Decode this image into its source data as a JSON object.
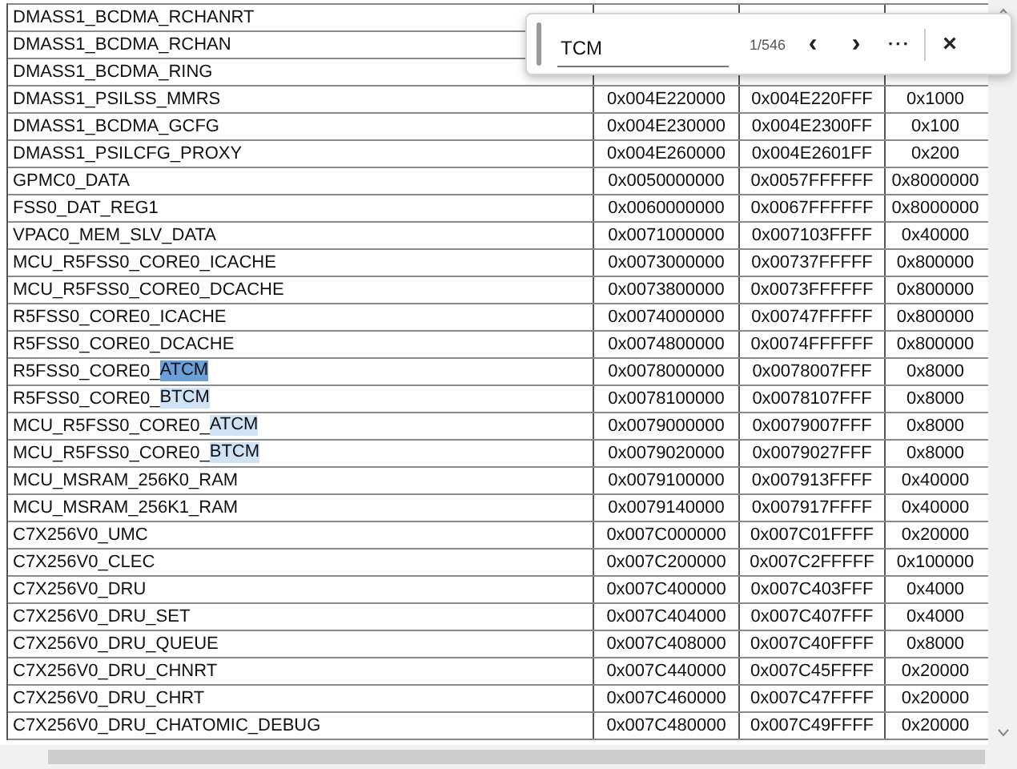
{
  "find_bar": {
    "query": "TCM",
    "count": "1/546",
    "prev": "‹",
    "next": "›",
    "more": "···",
    "close": "×"
  },
  "table": {
    "rows": [
      {
        "name": "DMASS1_BCDMA_RCHANRT"
      },
      {
        "name": "DMASS1_BCDMA_RCHAN"
      },
      {
        "name": "DMASS1_BCDMA_RING"
      },
      {
        "name": "DMASS1_PSILSS_MMRS",
        "start": "0x004E220000",
        "end": "0x004E220FFF",
        "size": "0x1000"
      },
      {
        "name": "DMASS1_BCDMA_GCFG",
        "start": "0x004E230000",
        "end": "0x004E2300FF",
        "size": "0x100"
      },
      {
        "name": "DMASS1_PSILCFG_PROXY",
        "start": "0x004E260000",
        "end": "0x004E2601FF",
        "size": "0x200"
      },
      {
        "name": "GPMC0_DATA",
        "start": "0x0050000000",
        "end": "0x0057FFFFFF",
        "size": "0x8000000"
      },
      {
        "name": "FSS0_DAT_REG1",
        "start": "0x0060000000",
        "end": "0x0067FFFFFF",
        "size": "0x8000000"
      },
      {
        "name": "VPAC0_MEM_SLV_DATA",
        "start": "0x0071000000",
        "end": "0x007103FFFF",
        "size": "0x40000"
      },
      {
        "name": "MCU_R5FSS0_CORE0_ICACHE",
        "start": "0x0073000000",
        "end": "0x00737FFFFF",
        "size": "0x800000"
      },
      {
        "name": "MCU_R5FSS0_CORE0_DCACHE",
        "start": "0x0073800000",
        "end": "0x0073FFFFFF",
        "size": "0x800000"
      },
      {
        "name": "R5FSS0_CORE0_ICACHE",
        "start": "0x0074000000",
        "end": "0x00747FFFFF",
        "size": "0x800000"
      },
      {
        "name": "R5FSS0_CORE0_DCACHE",
        "start": "0x0074800000",
        "end": "0x0074FFFFFF",
        "size": "0x800000"
      },
      {
        "name": "R5FSS0_CORE0_",
        "match": {
          "text": "ATCM",
          "current": true
        },
        "start": "0x0078000000",
        "end": "0x0078007FFF",
        "size": "0x8000"
      },
      {
        "name": "R5FSS0_CORE0_",
        "match": {
          "text": "BTCM",
          "current": false
        },
        "start": "0x0078100000",
        "end": "0x0078107FFF",
        "size": "0x8000"
      },
      {
        "name": "MCU_R5FSS0_CORE0_",
        "match": {
          "text": "ATCM",
          "current": false
        },
        "start": "0x0079000000",
        "end": "0x0079007FFF",
        "size": "0x8000"
      },
      {
        "name": "MCU_R5FSS0_CORE0_",
        "match": {
          "text": "BTCM",
          "current": false
        },
        "start": "0x0079020000",
        "end": "0x0079027FFF",
        "size": "0x8000"
      },
      {
        "name": "MCU_MSRAM_256K0_RAM",
        "start": "0x0079100000",
        "end": "0x007913FFFF",
        "size": "0x40000"
      },
      {
        "name": "MCU_MSRAM_256K1_RAM",
        "start": "0x0079140000",
        "end": "0x007917FFFF",
        "size": "0x40000"
      },
      {
        "name": "C7X256V0_UMC",
        "start": "0x007C000000",
        "end": "0x007C01FFFF",
        "size": "0x20000"
      },
      {
        "name": "C7X256V0_CLEC",
        "start": "0x007C200000",
        "end": "0x007C2FFFFF",
        "size": "0x100000"
      },
      {
        "name": "C7X256V0_DRU",
        "start": "0x007C400000",
        "end": "0x007C403FFF",
        "size": "0x4000"
      },
      {
        "name": "C7X256V0_DRU_SET",
        "start": "0x007C404000",
        "end": "0x007C407FFF",
        "size": "0x4000"
      },
      {
        "name": "C7X256V0_DRU_QUEUE",
        "start": "0x007C408000",
        "end": "0x007C40FFFF",
        "size": "0x8000"
      },
      {
        "name": "C7X256V0_DRU_CHNRT",
        "start": "0x007C440000",
        "end": "0x007C45FFFF",
        "size": "0x20000"
      },
      {
        "name": "C7X256V0_DRU_CHRT",
        "start": "0x007C460000",
        "end": "0x007C47FFFF",
        "size": "0x20000"
      },
      {
        "name": "C7X256V0_DRU_CHATOMIC_DEBUG",
        "start": "0x007C480000",
        "end": "0x007C49FFFF",
        "size": "0x20000"
      }
    ]
  }
}
